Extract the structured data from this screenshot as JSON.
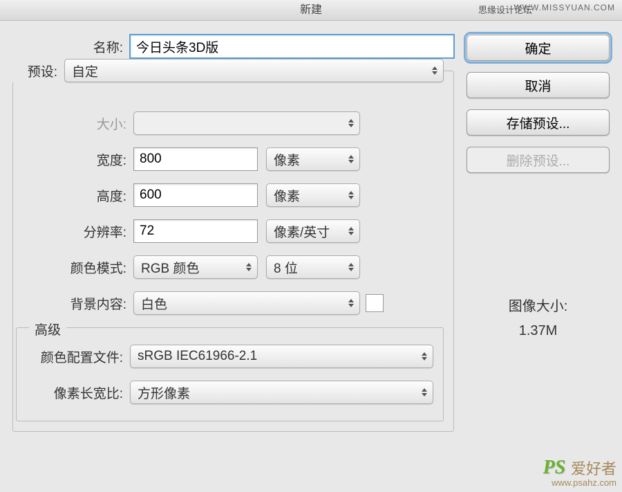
{
  "title": "新建",
  "watermarks": {
    "top_right_site": "思缘设计论坛",
    "top_right_url": "WWW.MISSYUAN.COM",
    "bottom_ps": "PS",
    "bottom_text": "爱好者",
    "bottom_url": "www.psahz.com"
  },
  "labels": {
    "name": "名称:",
    "preset": "预设:",
    "size": "大小:",
    "width": "宽度:",
    "height": "高度:",
    "resolution": "分辨率:",
    "colorMode": "颜色模式:",
    "bgContent": "背景内容:",
    "advanced": "高级",
    "colorProfile": "颜色配置文件:",
    "pixelAspect": "像素长宽比:"
  },
  "values": {
    "name": "今日头条3D版",
    "preset": "自定",
    "size": "",
    "width": "800",
    "widthUnit": "像素",
    "height": "600",
    "heightUnit": "像素",
    "resolution": "72",
    "resolutionUnit": "像素/英寸",
    "colorMode": "RGB 颜色",
    "bitDepth": "8 位",
    "bgContent": "白色",
    "colorProfile": "sRGB IEC61966-2.1",
    "pixelAspect": "方形像素"
  },
  "buttons": {
    "ok": "确定",
    "cancel": "取消",
    "savePreset": "存储预设...",
    "deletePreset": "删除预设..."
  },
  "info": {
    "imageSizeLabel": "图像大小:",
    "imageSizeValue": "1.37M"
  }
}
